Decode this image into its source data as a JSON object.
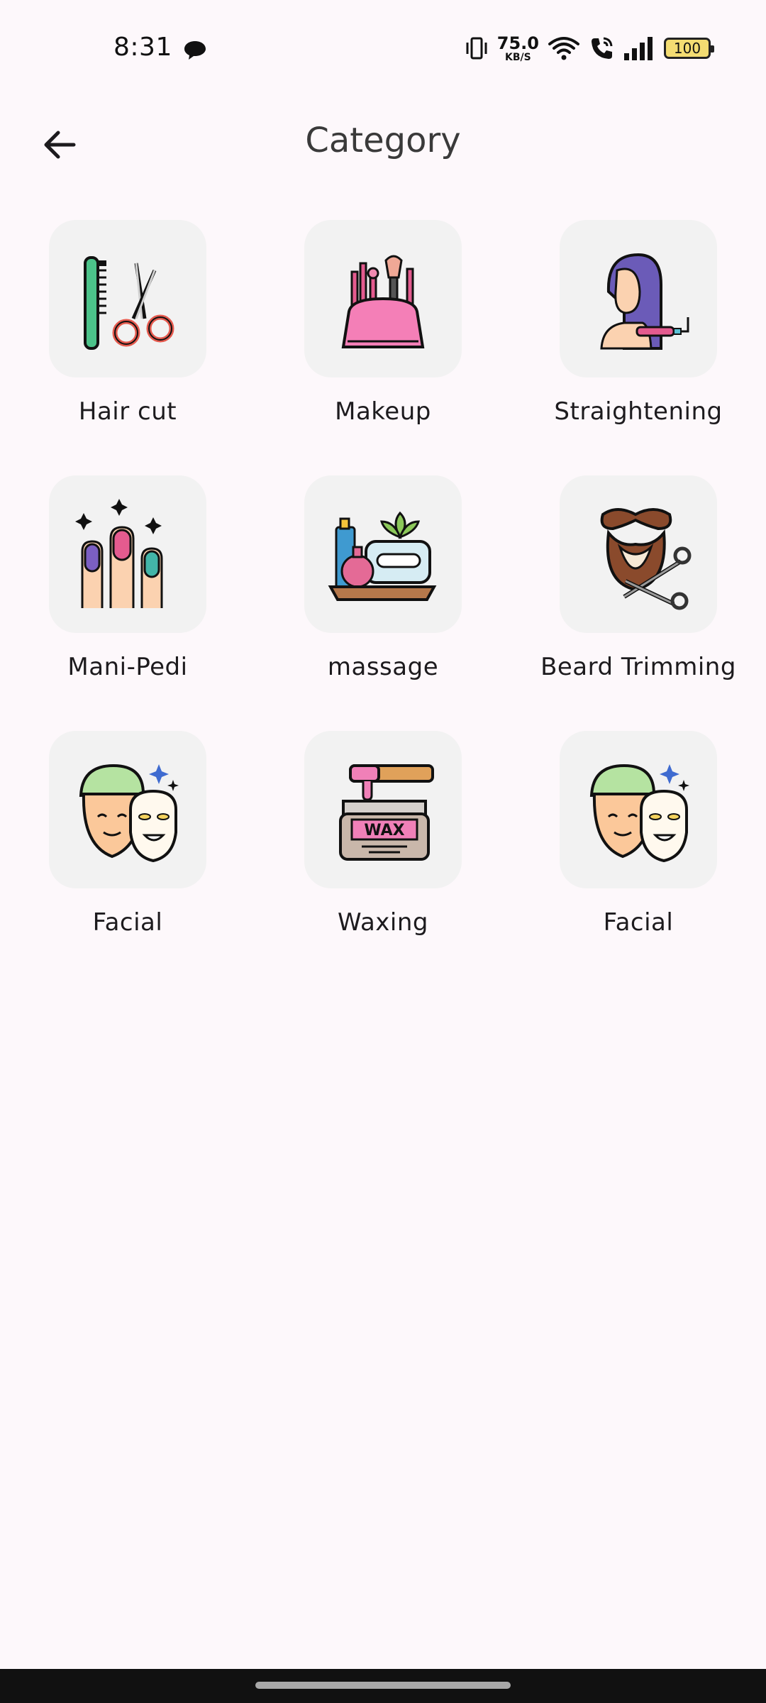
{
  "status_bar": {
    "time": "8:31",
    "net_speed_value": "75.0",
    "net_speed_unit": "KB/S",
    "battery": "100",
    "battery_color": "#f3dc72",
    "icons": [
      "chat-bubble-icon",
      "vibrate-icon",
      "wifi-icon",
      "call-icon",
      "signal-icon",
      "battery-icon"
    ]
  },
  "header": {
    "title": "Category",
    "back_icon": "arrow-left-icon"
  },
  "categories": [
    {
      "label": "Hair cut",
      "icon": "comb-scissors-icon"
    },
    {
      "label": "Makeup",
      "icon": "makeup-kit-icon"
    },
    {
      "label": "Straightening",
      "icon": "hair-straightener-icon"
    },
    {
      "label": "Mani-Pedi",
      "icon": "painted-nails-icon"
    },
    {
      "label": "massage",
      "icon": "spa-oils-icon"
    },
    {
      "label": "Beard Trimming",
      "icon": "beard-scissors-icon"
    },
    {
      "label": "Facial",
      "icon": "face-mask-icon"
    },
    {
      "label": "Waxing",
      "icon": "wax-jar-icon"
    },
    {
      "label": "Facial",
      "icon": "face-mask-icon"
    }
  ],
  "colors": {
    "background": "#fdf8fb",
    "tile": "#f2f2f2"
  }
}
